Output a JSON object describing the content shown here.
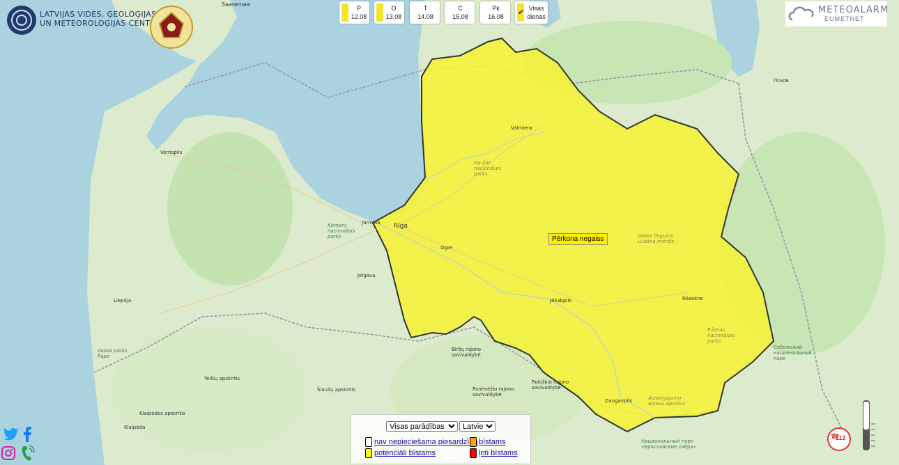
{
  "header": {
    "org_line1": "LATVIJAS VIDES, ĢEOLOĢIJAS",
    "org_line2": "UN METEOROLOĢIJAS CENTRS"
  },
  "days": [
    {
      "label": "P",
      "date": "12.08"
    },
    {
      "label": "O",
      "date": "13.08"
    },
    {
      "label": "T",
      "date": "14.08"
    },
    {
      "label": "C",
      "date": "15.08"
    },
    {
      "label": "Pk",
      "date": "16.08"
    }
  ],
  "all_days": {
    "line1": "Visas",
    "line2": "dienas",
    "checked": true
  },
  "meteoalarm": {
    "title": "METEOALARM",
    "subtitle": "EUMETNET"
  },
  "warning": {
    "label": "Pērkona negaiss",
    "color": "#ffff00"
  },
  "map_labels": {
    "saaremaa": "Saaremaa",
    "ventspils": "Ventspils",
    "liepaja": "Liepāja",
    "jelgava": "Jelgava",
    "jurmala": "Jūrmala",
    "riga": "Rīga",
    "ogre": "Ogre",
    "valmiera": "Valmiera",
    "jekabpils": "Jēkabpils",
    "rezekne": "Rēzekne",
    "daugavpils": "Daugavpils",
    "pskov": "Псков",
    "klaipeda": "Klaipėda",
    "kemeru": "Ķemeru nacionālais parks",
    "gaujas": "Gaujas nacionālais parks",
    "lubana": "dabas liegums Lubāna mitrājs",
    "razna": "Rāznas nacionālais parks",
    "dabas_parks_pape": "dabas parks Pape",
    "telsiu_apskritis": "Telšių apskritis",
    "siauliu_apskritis": "Šiaulių apskritis",
    "klaipedos_apskritis": "Klaipėdos apskritis",
    "panevezio_rajono": "Panevėžio rajono savivaldybė",
    "rokiskio_rajono": "Rokiškio rajono savivaldybė",
    "birzu_rajono": "Biržų rajono savivaldybė",
    "sebezh_park": "Себежский национальный парк",
    "braslav_park": "Национальный парк «Браславские озёра»",
    "aizsargajamo": "Aizsargājamo ainavu apvidus"
  },
  "legend": {
    "filter_selected": "Visas parādības",
    "language_selected": "Latviešu",
    "items": [
      {
        "label": "nav nepieciešama piesardzība",
        "color": "#ffffff"
      },
      {
        "label": "bīstams",
        "color": "#ffa500"
      },
      {
        "label": "potenciāli bīstams",
        "color": "#ffff00"
      },
      {
        "label": "ļoti bīstams",
        "color": "#ff0000"
      }
    ]
  },
  "emergency": {
    "number": "112"
  },
  "colors": {
    "sea": "#aad3df",
    "land": "#d9ecc9",
    "warning_fill": "#f5f238",
    "border": "#333333"
  }
}
